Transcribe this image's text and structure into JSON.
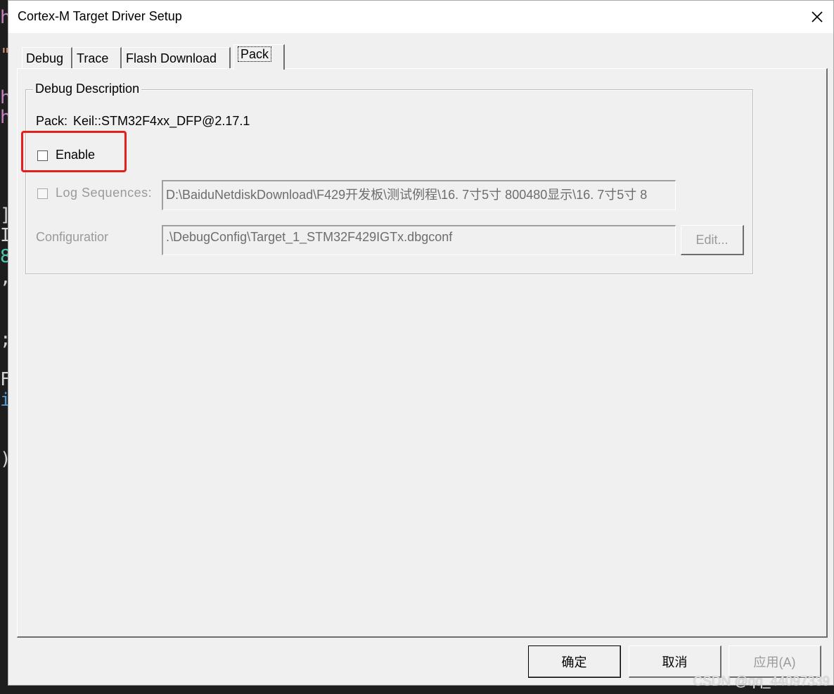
{
  "window": {
    "title": "Cortex-M Target Driver Setup"
  },
  "tabs": [
    {
      "label": "Debug",
      "active": false
    },
    {
      "label": "Trace",
      "active": false
    },
    {
      "label": "Flash Download",
      "active": false
    },
    {
      "label": "Pack",
      "active": true
    }
  ],
  "debug_description": {
    "legend": "Debug Description",
    "pack_label": "Pack:",
    "pack_value": "Keil::STM32F4xx_DFP@2.17.1",
    "enable": {
      "label": "Enable",
      "checked": false
    },
    "log_sequences": {
      "label": "Log Sequences:",
      "checked": false,
      "value": "D:\\BaiduNetdiskDownload\\F429开发板\\测试例程\\16. 7寸5寸 800480显示\\16. 7寸5寸 8"
    },
    "configuration": {
      "label": "Configuratior",
      "value": ".\\DebugConfig\\Target_1_STM32F429IGTx.dbgconf",
      "edit_label": "Edit..."
    }
  },
  "buttons": {
    "ok": "确定",
    "cancel": "取消",
    "apply": "应用(A)"
  },
  "watermark": "CSDN @qq_44097339",
  "colors": {
    "highlight_box": "#e3201b",
    "dialog_bg": "#f0f0f0",
    "disabled_text": "#9a9a9a"
  }
}
